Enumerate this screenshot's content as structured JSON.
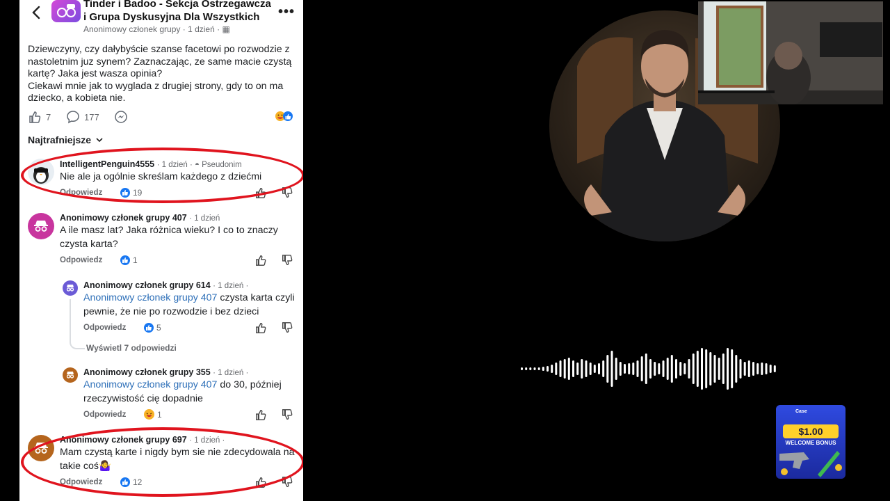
{
  "group": {
    "title": "Tinder i Badoo - Sekcja Ostrzegawcza i Grupa Dyskusyjna Dla Wszystkich",
    "author": "Anonimowy członek grupy",
    "time": "1 dzień"
  },
  "post": {
    "lines": [
      "Dziewczyny, czy dałybyście szanse facetowi po rozwodzie z nastoletnim juz synem? Zaznaczając, ze same macie czystą kartę? Jaka jest wasza opinia?",
      "Ciekawi mnie jak to wyglada z drugiej strony, gdy to on ma dziecko, a kobieta nie."
    ],
    "likes": "7",
    "comments": "177"
  },
  "sort_label": "Najtrafniejsze",
  "comments": [
    {
      "name": "IntelligentPenguin4555",
      "time": "1 dzień",
      "tag": "Pseudonim",
      "text": "Nie ale ja ogólnie skreślam każdego z dziećmi",
      "reply": "Odpowiedz",
      "likes": "19"
    },
    {
      "name": "Anonimowy członek grupy 407",
      "time": "1 dzień",
      "text": "A ile masz lat? Jaka różnica wieku? I co to znaczy czysta karta?",
      "reply": "Odpowiedz",
      "likes": "1"
    },
    {
      "name": "Anonimowy członek grupy 614",
      "time": "1 dzień",
      "mention": "Anonimowy członek grupy 407",
      "text": " czysta karta czyli pewnie, że nie po rozwodzie i bez dzieci",
      "reply": "Odpowiedz",
      "likes": "5"
    },
    {
      "name": "Anonimowy członek grupy 355",
      "time": "1 dzień",
      "mention": "Anonimowy członek grupy 407",
      "text": " do 30, później rzeczywistość cię dopadnie",
      "reply": "Odpowiedz",
      "likes": "1"
    },
    {
      "name": "Anonimowy członek grupy 697",
      "time": "1 dzień",
      "text": "Mam czystą karte i nigdy bym sie nie zdecydowala na takie coś🤷‍♀️",
      "reply": "Odpowiedz",
      "likes": "12"
    }
  ],
  "view_replies": "Wyświetl 7 odpowiedzi",
  "promo": {
    "amount": "$1.00",
    "label": "WELCOME BONUS",
    "brand": "Case"
  },
  "colors": {
    "accent": "#1877f2",
    "highlight": "#e0141e",
    "mention": "#2d6fb8"
  }
}
